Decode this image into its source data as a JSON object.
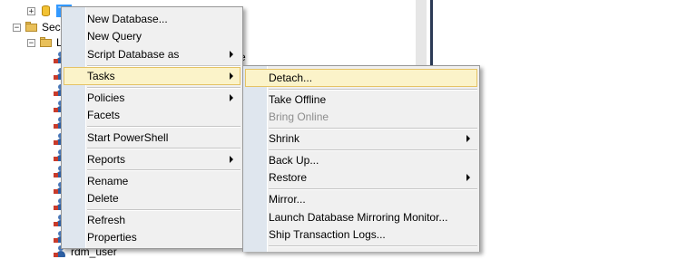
{
  "tree": {
    "database_label": "Te",
    "security_label": "Secu",
    "logins_label": "Lo",
    "partial_bottom_user": "rdm_user",
    "partial_right_glimpse": "e"
  },
  "context_menu": {
    "items": [
      {
        "label": "New Database..."
      },
      {
        "label": "New Query"
      },
      {
        "label": "Script Database as",
        "submenu": true
      },
      {
        "label": "Tasks",
        "submenu": true,
        "highlighted": true
      },
      {
        "label": "Policies",
        "submenu": true
      },
      {
        "label": "Facets"
      },
      {
        "label": "Start PowerShell"
      },
      {
        "label": "Reports",
        "submenu": true
      },
      {
        "label": "Rename"
      },
      {
        "label": "Delete"
      },
      {
        "label": "Refresh"
      },
      {
        "label": "Properties"
      }
    ]
  },
  "tasks_submenu": {
    "items": [
      {
        "label": "Detach...",
        "highlighted": true
      },
      {
        "label": "Take Offline"
      },
      {
        "label": "Bring Online",
        "disabled": true
      },
      {
        "label": "Shrink",
        "submenu": true
      },
      {
        "label": "Back Up..."
      },
      {
        "label": "Restore",
        "submenu": true
      },
      {
        "label": "Mirror..."
      },
      {
        "label": "Launch Database Mirroring Monitor..."
      },
      {
        "label": "Ship Transaction Logs..."
      }
    ]
  },
  "colors": {
    "menu_bg": "#f0f0f0",
    "gutter": "#dfe6ee",
    "highlight_bg": "#fbf3c9",
    "highlight_border": "#e5c365",
    "selection": "#3399ff",
    "disabled_text": "#8d8d8d"
  }
}
